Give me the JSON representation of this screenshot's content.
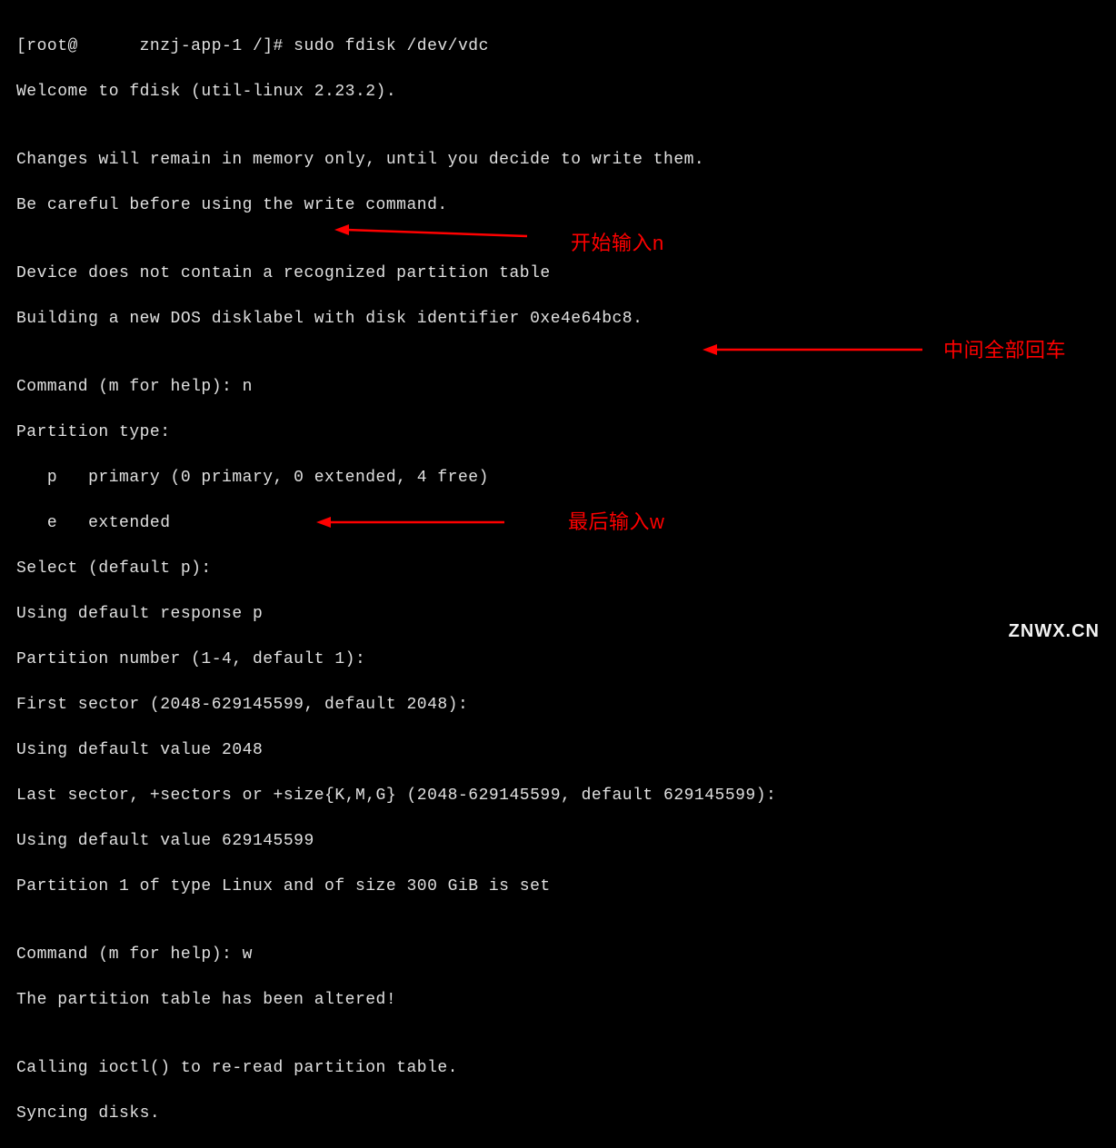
{
  "terminal": {
    "lines": [
      "[root@      znzj-app-1 /]# sudo fdisk /dev/vdc",
      "Welcome to fdisk (util-linux 2.23.2).",
      "",
      "Changes will remain in memory only, until you decide to write them.",
      "Be careful before using the write command.",
      "",
      "Device does not contain a recognized partition table",
      "Building a new DOS disklabel with disk identifier 0xe4e64bc8.",
      "",
      "Command (m for help): n",
      "Partition type:",
      "   p   primary (0 primary, 0 extended, 4 free)",
      "   e   extended",
      "Select (default p):",
      "Using default response p",
      "Partition number (1-4, default 1):",
      "First sector (2048-629145599, default 2048):",
      "Using default value 2048",
      "Last sector, +sectors or +size{K,M,G} (2048-629145599, default 629145599):",
      "Using default value 629145599",
      "Partition 1 of type Linux and of size 300 GiB is set",
      "",
      "Command (m for help): w",
      "The partition table has been altered!",
      "",
      "Calling ioctl() to re-read partition table.",
      "Syncing disks."
    ]
  },
  "annotations": {
    "note1": "开始输入n",
    "note2": "中间全部回车",
    "note3": "最后输入w"
  },
  "watermark": "ZNWX.CN"
}
